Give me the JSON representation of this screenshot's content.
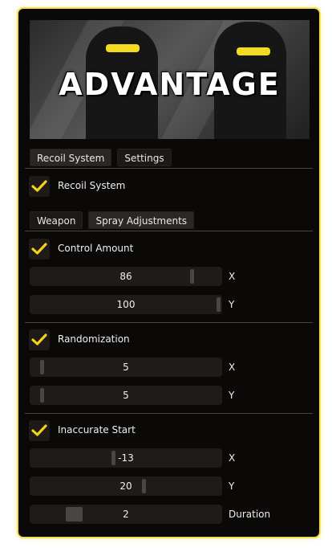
{
  "banner": {
    "title": "ADVANTAGE"
  },
  "main_tabs": [
    {
      "label": "Recoil System"
    },
    {
      "label": "Settings"
    }
  ],
  "recoil_system": {
    "label": "Recoil System",
    "checked": true
  },
  "sub_tabs": [
    {
      "label": "Weapon"
    },
    {
      "label": "Spray Adjustments"
    }
  ],
  "control_amount": {
    "label": "Control Amount",
    "checked": true,
    "x": {
      "value": "86",
      "axis": "X",
      "level": 0.86
    },
    "y": {
      "value": "100",
      "axis": "Y",
      "level": 1.0
    }
  },
  "randomization": {
    "label": "Randomization",
    "checked": true,
    "x": {
      "value": "5",
      "axis": "X",
      "level": 0.05
    },
    "y": {
      "value": "5",
      "axis": "Y",
      "level": 0.05
    }
  },
  "inaccurate_start": {
    "label": "Inaccurate Start",
    "checked": true,
    "x": {
      "value": "-13",
      "axis": "X",
      "level": 0.435
    },
    "y": {
      "value": "20",
      "axis": "Y",
      "level": 0.6
    },
    "duration": {
      "value": "2",
      "axis": "Duration",
      "level": 0.2
    }
  },
  "colors": {
    "accent": "#f3df4c",
    "check": "#f2d21e",
    "panel": "#0b0908"
  }
}
